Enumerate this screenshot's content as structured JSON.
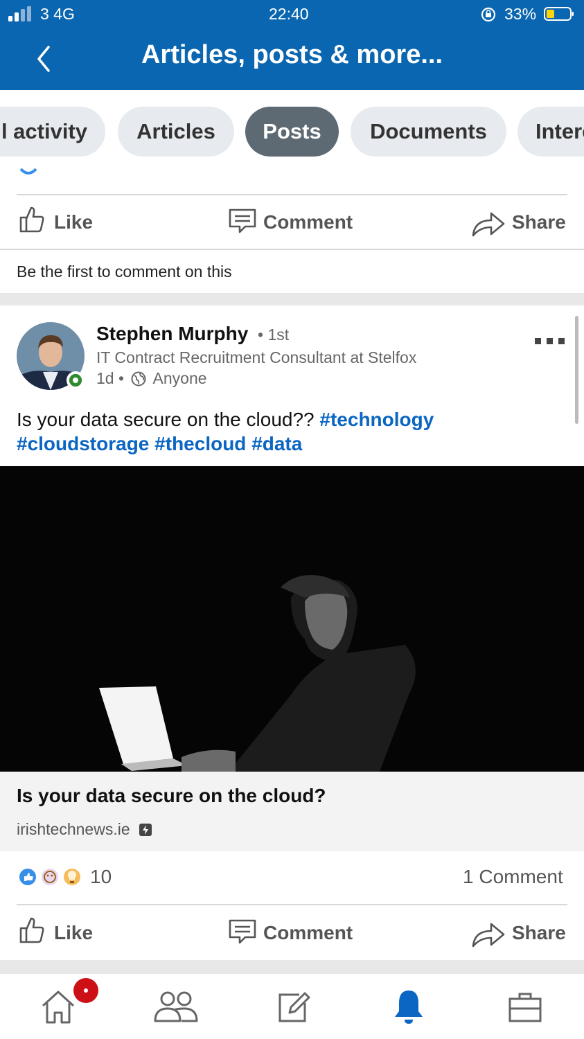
{
  "status_bar": {
    "carrier": "3 4G",
    "time": "22:40",
    "battery_pct": "33%"
  },
  "header": {
    "title": "Articles, posts & more..."
  },
  "tabs": [
    {
      "label": "All activity",
      "active": false
    },
    {
      "label": "Articles",
      "active": false
    },
    {
      "label": "Posts",
      "active": true
    },
    {
      "label": "Documents",
      "active": false
    },
    {
      "label": "Interests",
      "active": false
    }
  ],
  "previous_post": {
    "actions": {
      "like": "Like",
      "comment": "Comment",
      "share": "Share"
    },
    "comment_prompt": "Be the first to comment on this"
  },
  "post": {
    "author": "Stephen Murphy",
    "degree": "• 1st",
    "headline": "IT Contract Recruitment Consultant at Stelfox",
    "age": "1d •",
    "visibility": "Anyone",
    "text": "Is your data secure on the cloud??",
    "hashtags": [
      "#technology",
      "#cloudstorage",
      "#thecloud",
      "#data"
    ],
    "link_title": "Is your data secure on the cloud?",
    "link_domain": "irishtechnews.ie",
    "reaction_count": "10",
    "comment_count": "1 Comment",
    "actions": {
      "like": "Like",
      "comment": "Comment",
      "share": "Share"
    }
  },
  "bottom_nav": [
    "home-icon",
    "my-network-icon",
    "post-icon",
    "notifications-icon",
    "jobs-icon"
  ],
  "colors": {
    "brand": "#0a66b0",
    "tab_active": "#5e6a73",
    "hashtag": "#0a66c2",
    "badge": "#cc1016"
  }
}
